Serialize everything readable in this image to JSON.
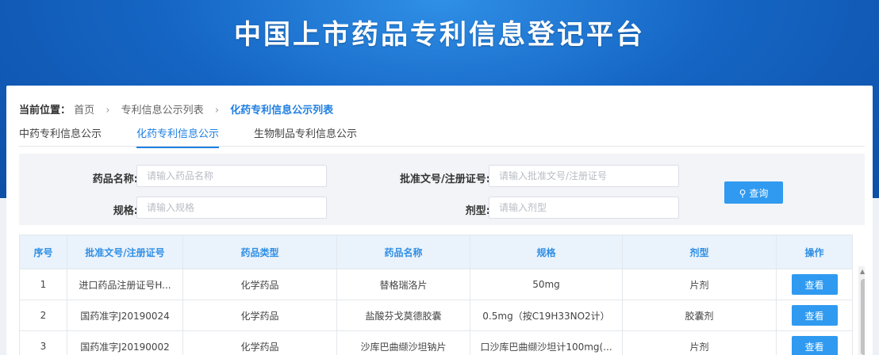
{
  "banner": {
    "title": "中国上市药品专利信息登记平台"
  },
  "breadcrumb": {
    "lead": "当前位置：",
    "items": [
      "首页",
      "专利信息公示列表",
      "化药专利信息公示列表"
    ]
  },
  "tabs": [
    "中药专利信息公示",
    "化药专利信息公示",
    "生物制品专利信息公示"
  ],
  "search": {
    "drug_name_label": "药品名称:",
    "drug_name_placeholder": "请输入药品名称",
    "approval_no_label": "批准文号/注册证号:",
    "approval_no_placeholder": "请输入批准文号/注册证号",
    "spec_label": "规格:",
    "spec_placeholder": "请输入规格",
    "form_label": "剂型:",
    "form_placeholder": "请输入剂型",
    "query_label": "查询"
  },
  "table": {
    "headers": [
      "序号",
      "批准文号/注册证号",
      "药品类型",
      "药品名称",
      "规格",
      "剂型",
      "操作"
    ],
    "rows": [
      [
        "1",
        "进口药品注册证号H...",
        "化学药品",
        "替格瑞洛片",
        "50mg",
        "片剂",
        "查看"
      ],
      [
        "2",
        "国药准字J20190024",
        "化学药品",
        "盐酸芬戈莫德胶囊",
        "0.5mg（按C19H33NO2计）",
        "胶囊剂",
        "查看"
      ],
      [
        "3",
        "国药准字J20190002",
        "化学药品",
        "沙库巴曲缬沙坦钠片",
        "口沙库巴曲缬沙坦计100mg(...",
        "片剂",
        "查看"
      ]
    ]
  }
}
